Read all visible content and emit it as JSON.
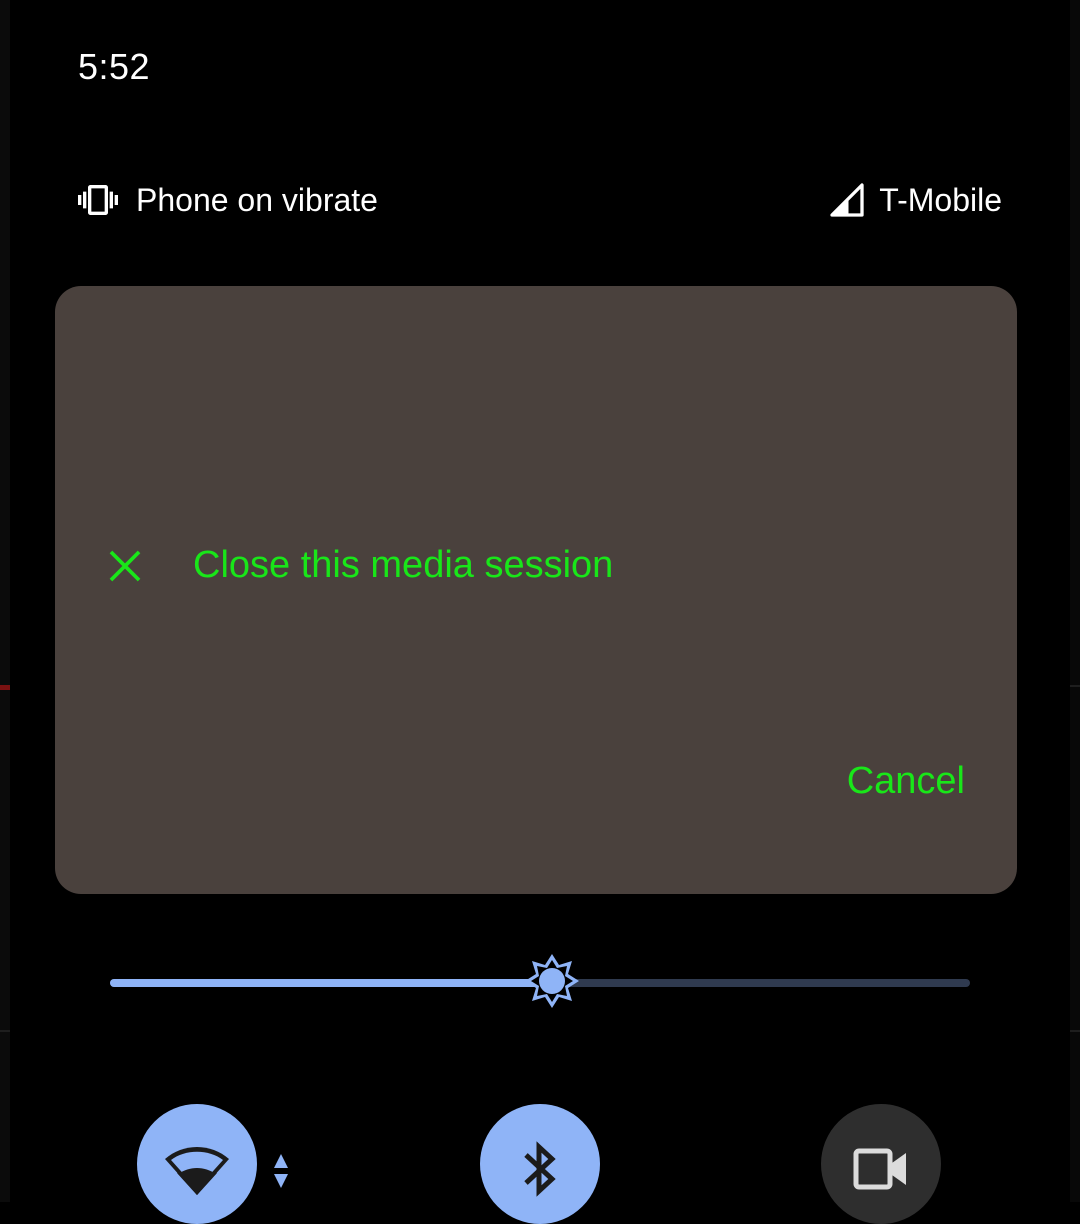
{
  "status_bar": {
    "time": "5:52"
  },
  "qs_header": {
    "ringer_icon": "vibrate-icon",
    "ringer_text": "Phone on vibrate",
    "signal_icon": "cell-signal-icon",
    "carrier": "T-Mobile"
  },
  "media_dialog": {
    "close_icon": "close-icon",
    "close_label": "Close this media session",
    "cancel_label": "Cancel",
    "background_color": "#4a413d",
    "action_color": "#19e619"
  },
  "brightness": {
    "icon": "brightness-icon",
    "level": 0.514,
    "active_color": "#8fb4f7",
    "inactive_color": "#2f3a4f"
  },
  "tiles": [
    {
      "name": "wifi",
      "icon": "wifi-icon",
      "state": "on"
    },
    {
      "name": "bluetooth",
      "icon": "bluetooth-icon",
      "state": "on"
    },
    {
      "name": "screen-record",
      "icon": "video-camera-icon",
      "state": "off"
    }
  ]
}
